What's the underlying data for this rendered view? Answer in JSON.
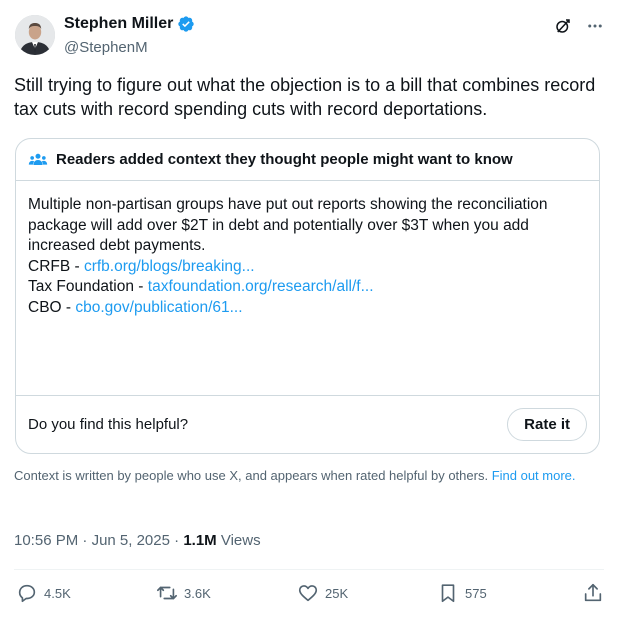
{
  "author": {
    "name": "Stephen Miller",
    "handle": "@StephenM",
    "verified": true,
    "verified_color": "#1d9bf0"
  },
  "tweet": {
    "text": "Still trying to figure out what the objection is to a bill that combines record tax cuts with record spending cuts with record deportations."
  },
  "community_note": {
    "title": "Readers added context they thought people might want to know",
    "body": "Multiple non-partisan groups have put out reports showing the reconciliation package will add over $2T in debt and potentially over $3T when you add increased debt payments.",
    "sources": [
      {
        "label": "CRFB - ",
        "link": "crfb.org/blogs/breaking..."
      },
      {
        "label": "Tax Foundation - ",
        "link": "taxfoundation.org/research/all/f..."
      },
      {
        "label": "CBO - ",
        "link": "cbo.gov/publication/61..."
      }
    ],
    "helpful_question": "Do you find this helpful?",
    "rate_button": "Rate it"
  },
  "context_footer": {
    "text": "Context is written by people who use X, and appears when rated helpful by others. ",
    "link": "Find out more."
  },
  "meta": {
    "time": "10:56 PM",
    "separator": " · ",
    "date": "Jun 5, 2025",
    "views_count": "1.1M",
    "views_label": " Views"
  },
  "actions": {
    "replies": "4.5K",
    "reposts": "3.6K",
    "likes": "25K",
    "bookmarks": "575"
  },
  "colors": {
    "accent": "#1d9bf0",
    "text_primary": "#0f1419",
    "text_secondary": "#536471",
    "border": "#cfd9de"
  },
  "icons": [
    "grok-icon",
    "more-icon",
    "community-notes-icon",
    "reply-icon",
    "repost-icon",
    "like-icon",
    "bookmark-icon",
    "share-icon"
  ]
}
